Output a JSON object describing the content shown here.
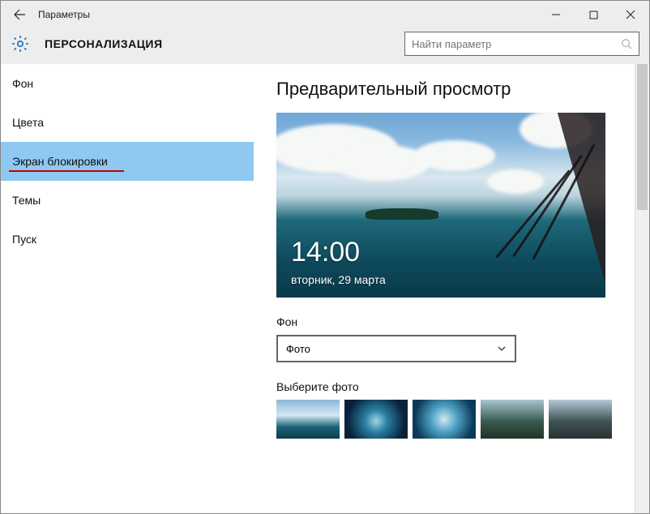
{
  "titlebar": {
    "title": "Параметры"
  },
  "header": {
    "heading": "ПЕРСОНАЛИЗАЦИЯ",
    "search_placeholder": "Найти параметр"
  },
  "sidebar": {
    "items": [
      {
        "label": "Фон"
      },
      {
        "label": "Цвета"
      },
      {
        "label": "Экран блокировки"
      },
      {
        "label": "Темы"
      },
      {
        "label": "Пуск"
      }
    ]
  },
  "content": {
    "preview_heading": "Предварительный просмотр",
    "clock": {
      "time": "14:00",
      "date": "вторник, 29 марта"
    },
    "background_label": "Фон",
    "background_selected": "Фото",
    "choose_photo_label": "Выберите фото"
  }
}
